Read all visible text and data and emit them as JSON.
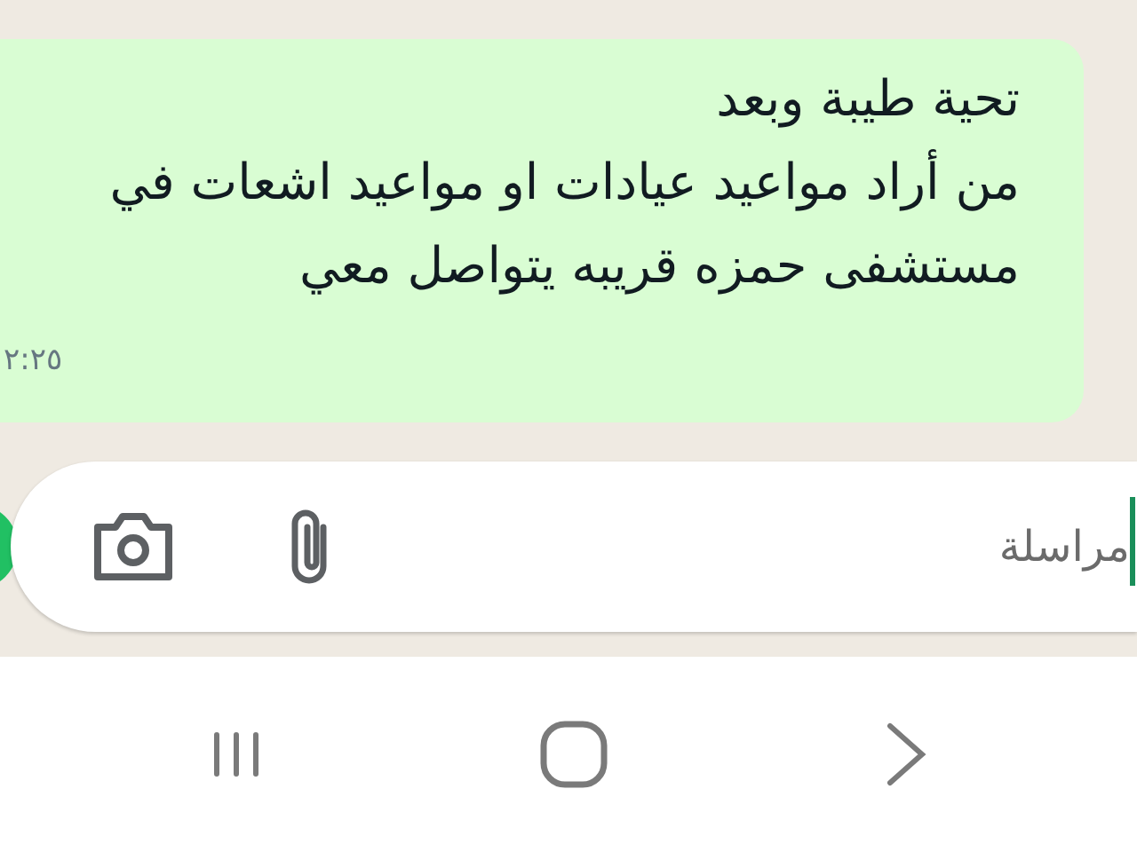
{
  "message": {
    "lines": [
      "تحية طيبة وبعد",
      "من أراد مواعيد عيادات او مواعيد اشعات في",
      "مستشفى حمزه قريبه يتواصل معي"
    ],
    "time": "٢:٢٥"
  },
  "composer": {
    "placeholder": "مراسلة"
  }
}
